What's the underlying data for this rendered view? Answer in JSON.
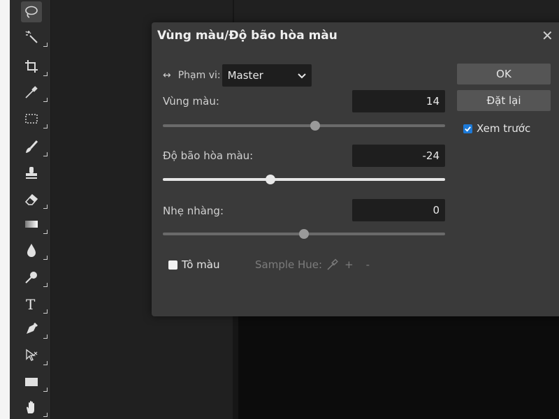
{
  "toolbar": {
    "tools": [
      {
        "name": "lasso-tool",
        "icon": "lasso-icon",
        "active": true
      },
      {
        "name": "magic-wand-tool",
        "icon": "magic-wand-icon"
      },
      {
        "name": "crop-tool",
        "icon": "crop-icon"
      },
      {
        "name": "eyedropper-tool",
        "icon": "eyedropper-icon"
      },
      {
        "name": "marquee-tool",
        "icon": "marquee-icon"
      },
      {
        "name": "brush-tool",
        "icon": "brush-icon"
      },
      {
        "name": "stamp-tool",
        "icon": "stamp-icon"
      },
      {
        "name": "eraser-tool",
        "icon": "eraser-icon"
      },
      {
        "name": "gradient-tool",
        "icon": "gradient-icon"
      },
      {
        "name": "blur-tool",
        "icon": "drop-icon"
      },
      {
        "name": "dodge-tool",
        "icon": "dodge-icon"
      },
      {
        "name": "type-tool",
        "icon": "type-icon"
      },
      {
        "name": "pen-tool",
        "icon": "pen-icon"
      },
      {
        "name": "path-select-tool",
        "icon": "path-select-icon"
      },
      {
        "name": "shape-tool",
        "icon": "rectangle-icon"
      },
      {
        "name": "hand-tool",
        "icon": "hand-icon"
      }
    ]
  },
  "dialog": {
    "title": "Vùng màu/Độ bão hòa màu",
    "close": "✕",
    "range_arrows": "↔",
    "range_label": "Phạm vi:",
    "range_value": "Master",
    "hue": {
      "label": "Vùng màu:",
      "value": "14",
      "fraction": 0.54
    },
    "saturation": {
      "label": "Độ bão hòa màu:",
      "value": "-24",
      "fraction": 0.38
    },
    "lightness": {
      "label": "Nhẹ nhàng:",
      "value": "0",
      "fraction": 0.5
    },
    "ok_label": "OK",
    "reset_label": "Đặt lại",
    "preview_label": "Xem trước",
    "preview_checked": true,
    "colorize_label": "Tô màu",
    "colorize_checked": false,
    "sample_hue_label": "Sample Hue:",
    "plus": "+",
    "minus": "-"
  },
  "colors": {
    "accent": "#1d7ad8",
    "dialog_bg": "#3a3a3a",
    "field_bg": "#1e1e1e"
  }
}
